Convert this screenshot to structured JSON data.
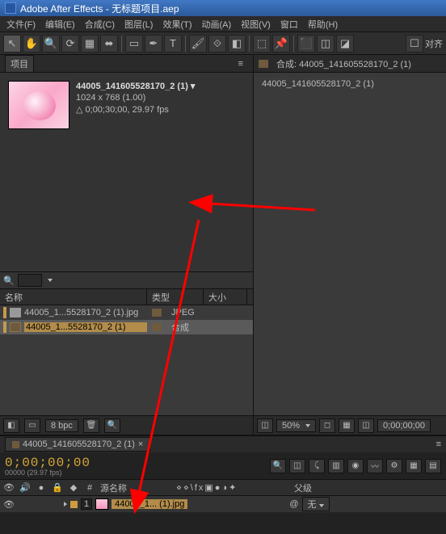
{
  "title": "Adobe After Effects - 无标题项目.aep",
  "menu": [
    "文件(F)",
    "编辑(E)",
    "合成(C)",
    "图层(L)",
    "效果(T)",
    "动画(A)",
    "视图(V)",
    "窗口",
    "帮助(H)"
  ],
  "toolbar_right_label": "对齐",
  "project": {
    "tab": "项目",
    "selected_name": "44005_141605528170_2 (1) ▾",
    "dims": "1024 x 768 (1.00)",
    "dur": "△ 0;00;30;00, 29.97 fps",
    "search_placeholder": "",
    "cols": {
      "c1": "名称",
      "c2": "类型",
      "c3": "大小"
    },
    "rows": [
      {
        "name": "44005_1...5528170_2 (1).jpg",
        "type": "JPEG",
        "kind": "file",
        "sel": false
      },
      {
        "name": "44005_1...5528170_2 (1)",
        "type": "合成",
        "kind": "comp",
        "sel": true
      }
    ],
    "bpc": "8 bpc"
  },
  "comp_panel": {
    "title": "合成: 44005_141605528170_2 (1)",
    "item": "44005_141605528170_2 (1)"
  },
  "viewer": {
    "zoom": "50%",
    "time": "0;00;00;00"
  },
  "timeline": {
    "tab": "44005_141605528170_2 (1)",
    "timecode": "0;00;00;00",
    "tcsub": "00000 (29.97 fps)",
    "head_source": "源名称",
    "head_parent": "父级",
    "parent_none": "无",
    "layers": [
      {
        "num": "1",
        "name": "44005_1... (1).jpg"
      }
    ]
  }
}
